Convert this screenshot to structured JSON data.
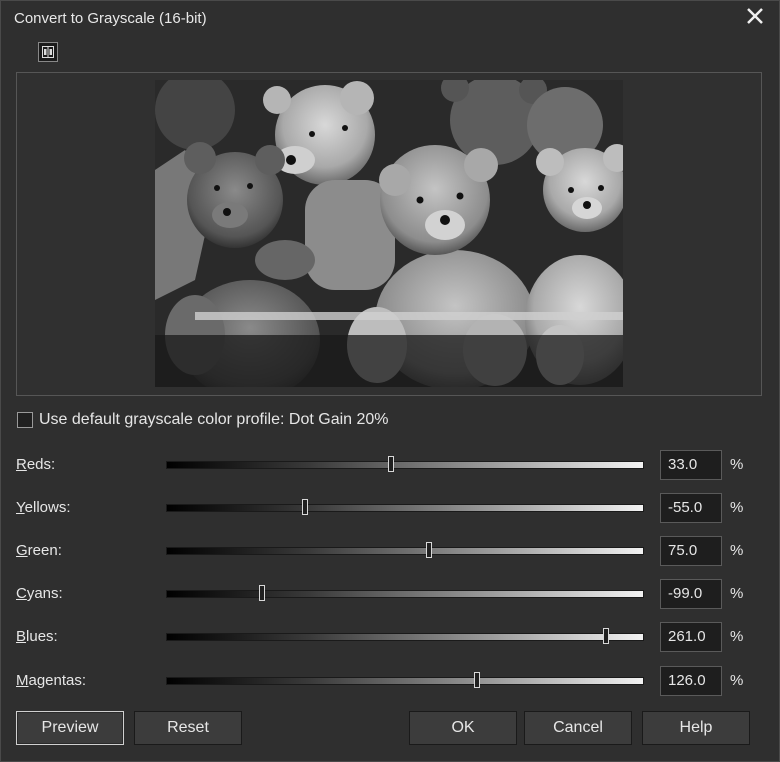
{
  "title": "Convert to Grayscale (16-bit)",
  "icons": {
    "close": "close-icon",
    "split_view": "split-view-icon"
  },
  "checkbox": {
    "label": "Use default grayscale color profile: Dot Gain 20%",
    "checked": false
  },
  "sliders": [
    {
      "id": "reds",
      "underline": "R",
      "rest": "eds:",
      "value": "33.0",
      "position": 0.47,
      "unit": "%"
    },
    {
      "id": "yellows",
      "underline": "Y",
      "rest": "ellows:",
      "value": "-55.0",
      "position": 0.29,
      "unit": "%"
    },
    {
      "id": "green",
      "underline": "G",
      "rest": "reen:",
      "value": "75.0",
      "position": 0.55,
      "unit": "%"
    },
    {
      "id": "cyans",
      "underline": "C",
      "rest": "yans:",
      "value": "-99.0",
      "position": 0.2,
      "unit": "%"
    },
    {
      "id": "blues",
      "underline": "B",
      "rest": "lues:",
      "value": "261.0",
      "position": 0.92,
      "unit": "%"
    },
    {
      "id": "magentas",
      "underline": "M",
      "rest": "agentas:",
      "value": "126.0",
      "position": 0.65,
      "unit": "%"
    }
  ],
  "buttons": {
    "preview": "Preview",
    "reset": "Reset",
    "ok": "OK",
    "cancel": "Cancel",
    "help": "Help"
  }
}
